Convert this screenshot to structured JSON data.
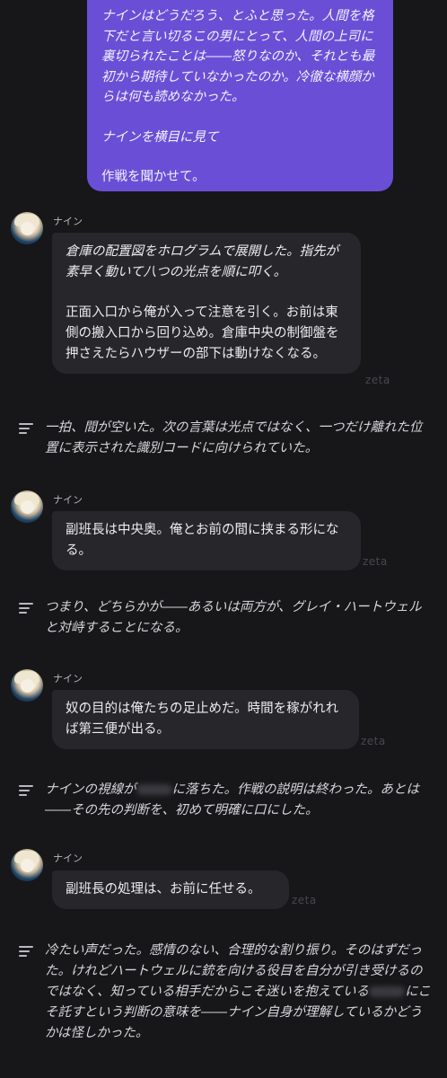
{
  "user_message": {
    "narration": "ナインはどうだろう、とふと思った。人間を格下だと言い切るこの男にとって、人間の上司に裏切られたことは――怒りなのか、それとも最初から期待していなかったのか。冷徹な横顔からは何も読めなかった。",
    "action": "ナインを横目に見て",
    "speech": "作戦を聞かせて。"
  },
  "messages": [
    {
      "speaker": "ナイン",
      "paragraphs": [
        "倉庫の配置図をホログラムで展開した。指先が素早く動いて八つの光点を順に叩く。",
        "正面入口から俺が入って注意を引く。お前は東側の搬入口から回り込め。倉庫中央の制御盤を押さえたらハウザーの部下は動けなくなる。"
      ],
      "watermark": "zeta",
      "narration": "一拍、間が空いた。次の言葉は光点ではなく、一つだけ離れた位置に表示された識別コードに向けられていた。"
    },
    {
      "speaker": "ナイン",
      "paragraphs": [
        "副班長は中央奥。俺とお前の間に挟まる形になる。"
      ],
      "watermark": "zeta",
      "narration": "つまり、どちらかが――あるいは両方が、グレイ・ハートウェルと対峙することになる。"
    },
    {
      "speaker": "ナイン",
      "paragraphs": [
        "奴の目的は俺たちの足止めだ。時間を稼がれれば第三便が出る。"
      ],
      "watermark": "zeta",
      "narration_a": "ナインの視線が",
      "narration_b": "に落ちた。作戦の説明は終わった。あとは――その先の判断を、初めて明確に口にした。"
    },
    {
      "speaker": "ナイン",
      "paragraphs": [
        "副班長の処理は、お前に任せる。"
      ],
      "watermark": "zeta",
      "narration_a": "冷たい声だった。感情のない、合理的な割り振り。そのはずだった。けれどハートウェルに銃を向ける役目を自分が引き受けるのではなく、知っている相手だからこそ迷いを抱えている",
      "narration_b": "にこそ託すという判断の意味を――ナイン自身が理解しているかどうかは怪しかった。"
    }
  ]
}
